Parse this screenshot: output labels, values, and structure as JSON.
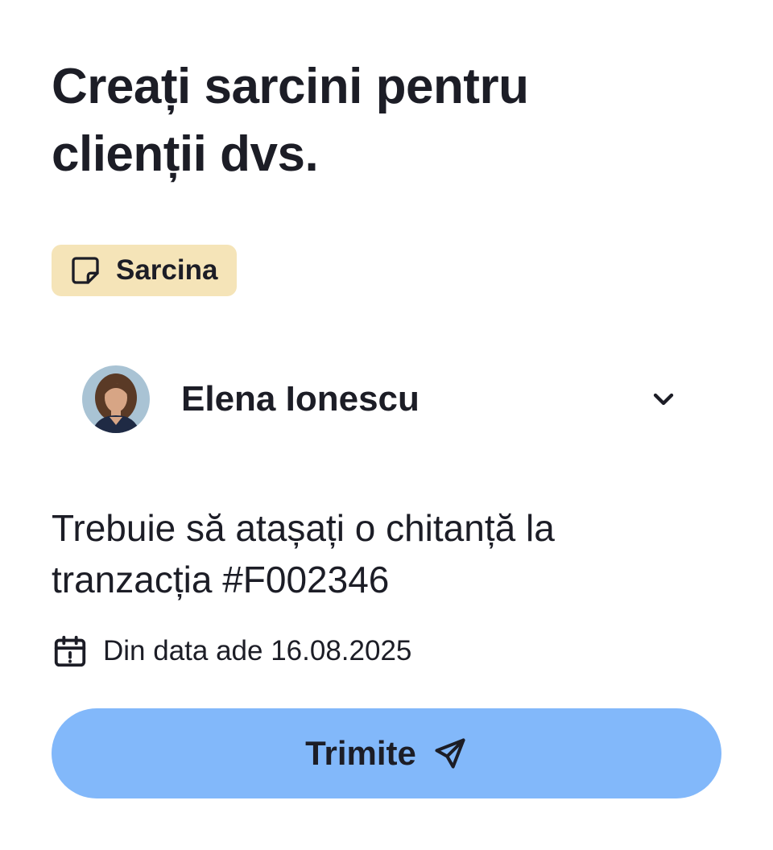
{
  "header": {
    "title": "Creați sarcini pentru clienții dvs."
  },
  "tag": {
    "icon": "sticky-note-icon",
    "label": "Sarcina",
    "color": "#f5e4b8"
  },
  "assignee": {
    "name": "Elena Ionescu",
    "avatar": "avatar-photo",
    "dropdown_icon": "chevron-down-icon"
  },
  "task": {
    "description": "Trebuie să atașați o chitanță la tranzacția #F002346",
    "date_icon": "calendar-alert-icon",
    "date_text": "Din data ade 16.08.2025"
  },
  "actions": {
    "send_label": "Trimite",
    "send_icon": "send-icon",
    "send_color": "#82b8fa"
  }
}
